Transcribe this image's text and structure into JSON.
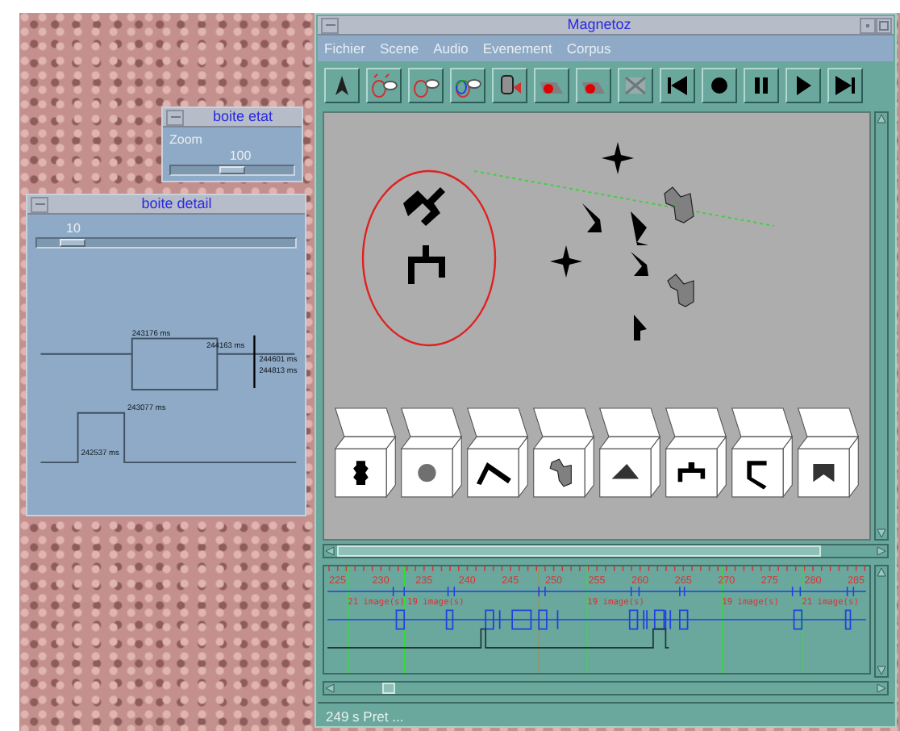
{
  "state_box": {
    "title": "boite etat",
    "label": "Zoom",
    "value": "100",
    "level": 0.5
  },
  "detail_box": {
    "title": "boite detail",
    "value": "10",
    "level": 0.1,
    "timestamps": [
      "243176 ms",
      "244163 ms",
      "244601 ms",
      "244813 ms",
      "243077 ms",
      "242537 ms"
    ]
  },
  "main_window": {
    "title": "Magnetoz",
    "menu": [
      "Fichier",
      "Scene",
      "Audio",
      "Evenement",
      "Corpus"
    ],
    "toolbar": [
      {
        "kind": "pointer"
      },
      {
        "kind": "lasso-pair"
      },
      {
        "kind": "lasso"
      },
      {
        "kind": "lasso-color"
      },
      {
        "kind": "face-camera"
      },
      {
        "kind": "record-shape"
      },
      {
        "kind": "record-shape"
      },
      {
        "kind": "cross"
      },
      {
        "kind": "rewind"
      },
      {
        "kind": "record"
      },
      {
        "kind": "pause"
      },
      {
        "kind": "play"
      },
      {
        "kind": "fast-forward"
      }
    ],
    "boxes": [
      {
        "kind": "totem"
      },
      {
        "kind": "disc"
      },
      {
        "kind": "chevron"
      },
      {
        "kind": "blob"
      },
      {
        "kind": "triangle"
      },
      {
        "kind": "fork"
      },
      {
        "kind": "hook"
      },
      {
        "kind": "notch"
      }
    ],
    "timeline": {
      "ticks": [
        "225",
        "230",
        "235",
        "240",
        "245",
        "250",
        "255",
        "260",
        "265",
        "270",
        "275",
        "280",
        "285"
      ],
      "segments": [
        "21 image(s)",
        "19 image(s)",
        "19 image(s)",
        "19 image(s)",
        "21 image(s)"
      ]
    },
    "status_bar": "249 s Pret ..."
  }
}
